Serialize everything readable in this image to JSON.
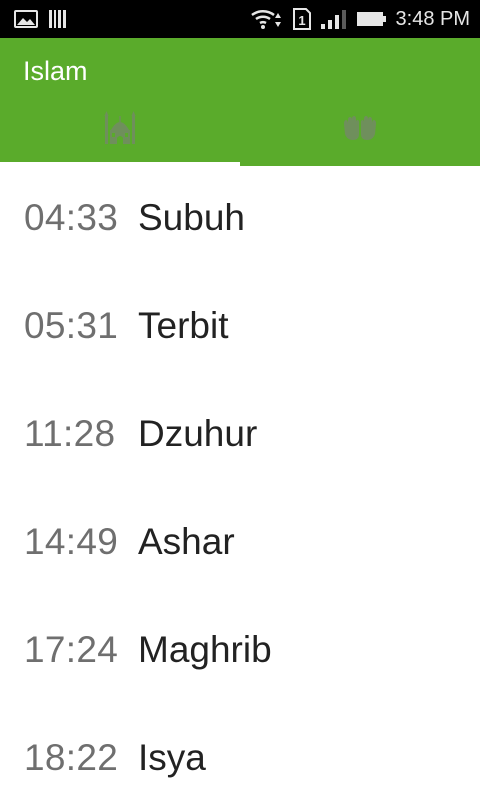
{
  "status_bar": {
    "time": "3:48 PM",
    "sim_slot": "1",
    "icons": [
      "gallery-icon",
      "barcode-icon",
      "wifi-icon",
      "sim-icon",
      "signal-icon",
      "battery-icon"
    ]
  },
  "app_bar": {
    "title": "Islam",
    "color": "#5aab2b",
    "tabs": [
      {
        "icon": "mosque-icon",
        "selected": true
      },
      {
        "icon": "praying-hands-icon",
        "selected": false
      }
    ]
  },
  "prayers": [
    {
      "time": "04:33",
      "name": "Subuh"
    },
    {
      "time": "05:31",
      "name": "Terbit"
    },
    {
      "time": "11:28",
      "name": "Dzuhur"
    },
    {
      "time": "14:49",
      "name": "Ashar"
    },
    {
      "time": "17:24",
      "name": "Maghrib"
    },
    {
      "time": "18:22",
      "name": "Isya"
    }
  ]
}
